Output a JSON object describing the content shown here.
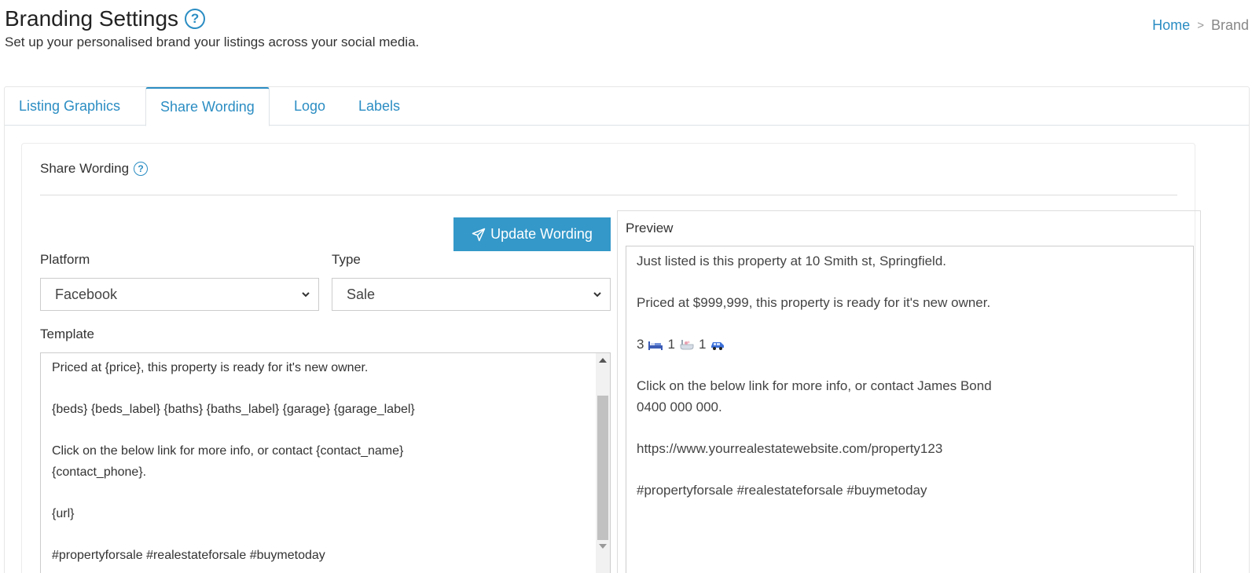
{
  "header": {
    "title": "Branding Settings",
    "subtitle": "Set up your personalised brand your listings across your social media."
  },
  "breadcrumb": {
    "home": "Home",
    "separator": ">",
    "current": "Brand"
  },
  "tabs": [
    {
      "label": "Listing Graphics",
      "active": false
    },
    {
      "label": "Share Wording",
      "active": true
    },
    {
      "label": "Logo",
      "active": false
    },
    {
      "label": "Labels",
      "active": false
    }
  ],
  "section": {
    "title": "Share Wording",
    "update_button": "Update Wording"
  },
  "form": {
    "platform_label": "Platform",
    "platform_value": "Facebook",
    "type_label": "Type",
    "type_value": "Sale",
    "template_label": "Template",
    "template_text": "Priced at {price}, this property is ready for it's new owner.\n\n{beds} {beds_label} {baths} {baths_label} {garage} {garage_label}\n\nClick on the below link for more info, or contact {contact_name}\n{contact_phone}.\n\n{url}\n\n#propertyforsale #realestateforsale #buymetoday"
  },
  "preview": {
    "title": "Preview",
    "line1": "Just listed is this property at 10 Smith st, Springfield.",
    "line2": "Priced at $999,999, this property is ready for it's new owner.",
    "beds": "3",
    "baths": "1",
    "garage": "1",
    "line4": "Click on the below link for more info, or contact James Bond",
    "line5": "0400 000 000.",
    "line6": "https://www.yourrealestatewebsite.com/property123",
    "line7": "#propertyforsale #realestateforsale #buymetoday"
  },
  "colors": {
    "accent": "#2b8dc3",
    "button": "#3498c9"
  },
  "icons": [
    "help-icon",
    "paper-plane-icon",
    "chevron-down-icon",
    "bed-icon",
    "bath-icon",
    "car-icon"
  ]
}
